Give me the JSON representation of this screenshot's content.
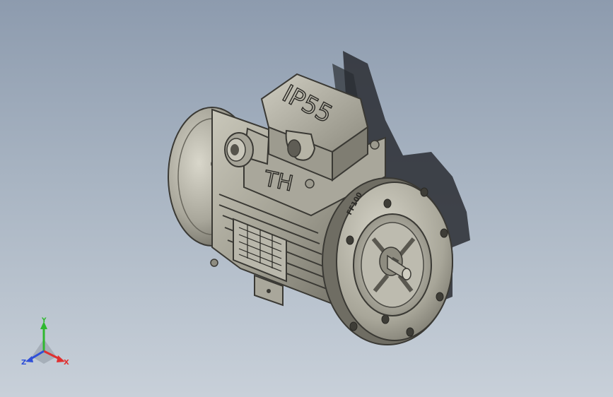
{
  "model": {
    "name": "motor",
    "box_marking": "IP55",
    "brand_marking": "TH",
    "flange_marking": "FF100"
  },
  "triad": {
    "x_label": "X",
    "y_label": "Y",
    "z_label": "Z"
  },
  "colors": {
    "metal": "#b6b4a6",
    "metal_dark": "#6e6c62",
    "background_top": "#8d9bae",
    "background_bottom": "#c8d0d9",
    "shadow": "#2a2d32",
    "axis_x": "#e03030",
    "axis_y": "#2fb82f",
    "axis_z": "#2f4fd8"
  }
}
